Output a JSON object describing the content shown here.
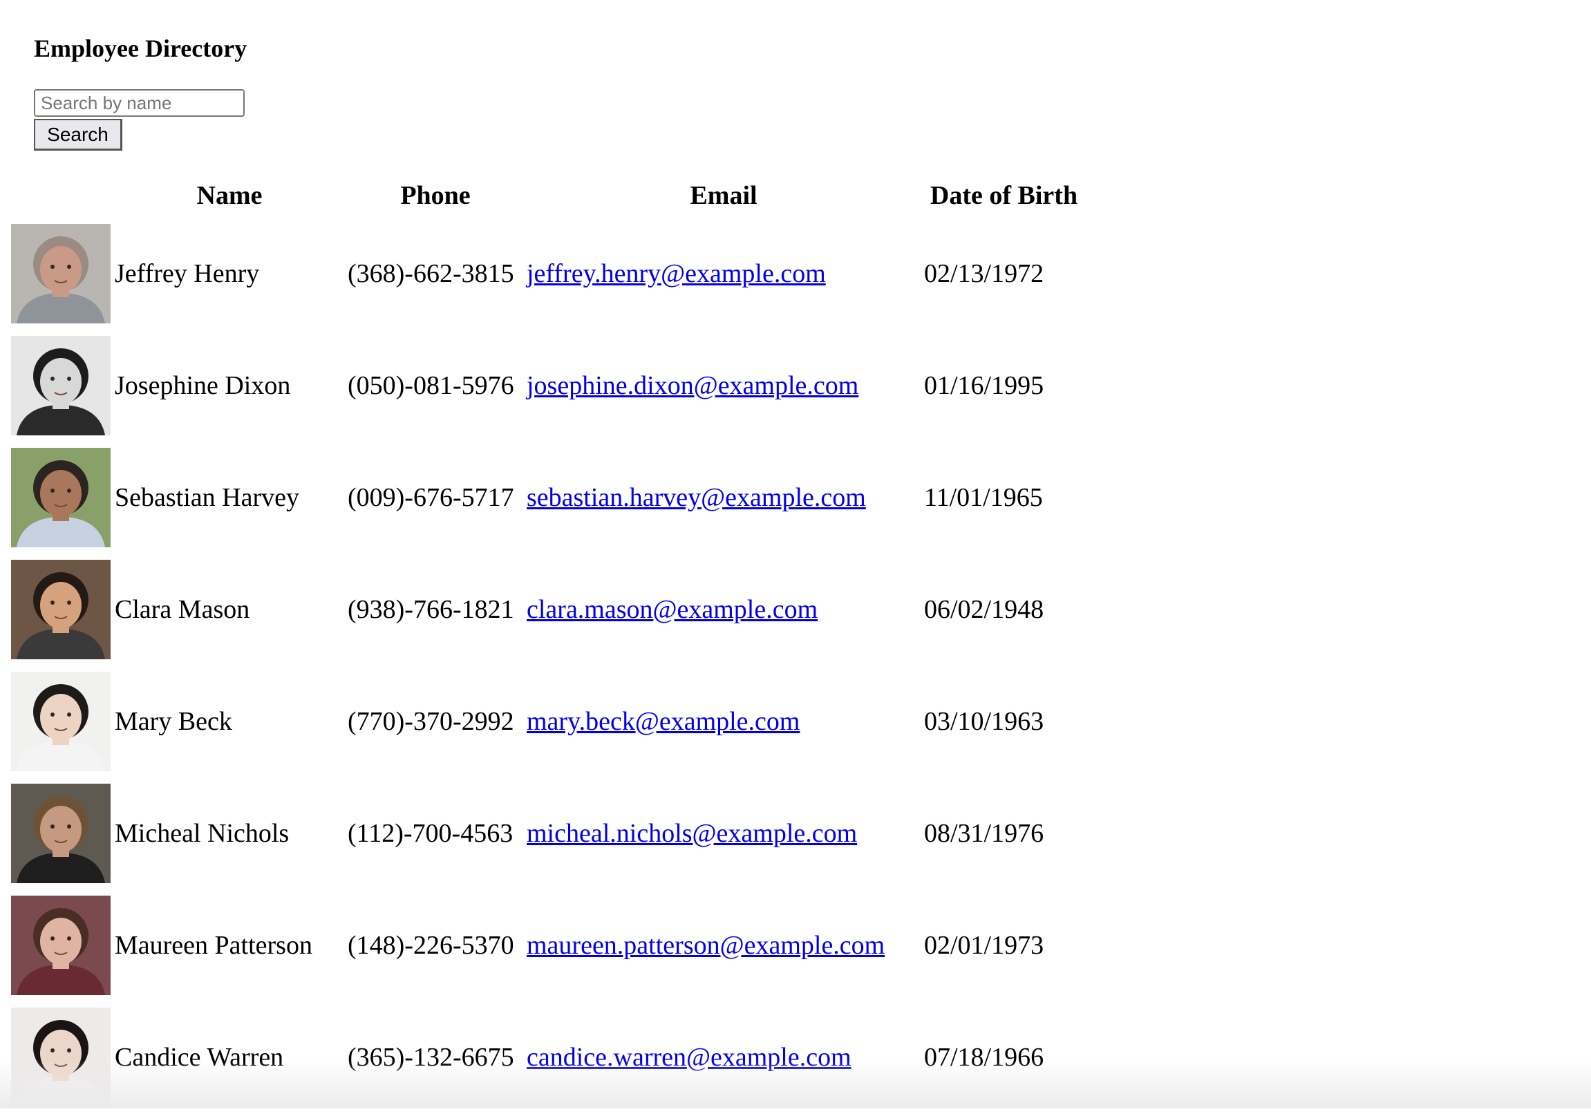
{
  "page": {
    "title": "Employee Directory"
  },
  "search": {
    "placeholder": "Search by name",
    "value": "",
    "button_label": "Search"
  },
  "table": {
    "headers": {
      "name": "Name",
      "phone": "Phone",
      "email": "Email",
      "dob": "Date of Birth"
    },
    "rows": [
      {
        "name": "Jeffrey Henry",
        "phone": "(368)-662-3815",
        "email": "jeffrey.henry@example.com",
        "dob": "02/13/1972",
        "photo": {
          "bg": "#b9b6b2",
          "face": "#c99a86",
          "hair": "#9a8c82",
          "shirt": "#8e9499"
        }
      },
      {
        "name": "Josephine Dixon",
        "phone": "(050)-081-5976",
        "email": "josephine.dixon@example.com",
        "dob": "01/16/1995",
        "photo": {
          "bg": "#e6e6e6",
          "face": "#d8d8d8",
          "hair": "#1c1c1c",
          "shirt": "#2a2a2a"
        }
      },
      {
        "name": "Sebastian Harvey",
        "phone": "(009)-676-5717",
        "email": "sebastian.harvey@example.com",
        "dob": "11/01/1965",
        "photo": {
          "bg": "#8aa06a",
          "face": "#a8775c",
          "hair": "#2c2420",
          "shirt": "#c6d2e2"
        }
      },
      {
        "name": "Clara Mason",
        "phone": "(938)-766-1821",
        "email": "clara.mason@example.com",
        "dob": "06/02/1948",
        "photo": {
          "bg": "#6e5646",
          "face": "#d6a27e",
          "hair": "#241a14",
          "shirt": "#3a3a3a"
        }
      },
      {
        "name": "Mary Beck",
        "phone": "(770)-370-2992",
        "email": "mary.beck@example.com",
        "dob": "03/10/1963",
        "photo": {
          "bg": "#f1f1f0",
          "face": "#ecd3c2",
          "hair": "#1e1a18",
          "shirt": "#f4f4f4"
        }
      },
      {
        "name": "Micheal Nichols",
        "phone": "(112)-700-4563",
        "email": "micheal.nichols@example.com",
        "dob": "08/31/1976",
        "photo": {
          "bg": "#5e5a52",
          "face": "#c69a80",
          "hair": "#6e5238",
          "shirt": "#1e1e1e"
        }
      },
      {
        "name": "Maureen Patterson",
        "phone": "(148)-226-5370",
        "email": "maureen.patterson@example.com",
        "dob": "02/01/1973",
        "photo": {
          "bg": "#7a4a4e",
          "face": "#e0b4a2",
          "hair": "#4a2e26",
          "shirt": "#6a2a34"
        }
      },
      {
        "name": "Candice Warren",
        "phone": "(365)-132-6675",
        "email": "candice.warren@example.com",
        "dob": "07/18/1966",
        "photo": {
          "bg": "#eeeaea",
          "face": "#ecd6ca",
          "hair": "#1a1414",
          "shirt": "#f2eeee"
        }
      }
    ]
  }
}
